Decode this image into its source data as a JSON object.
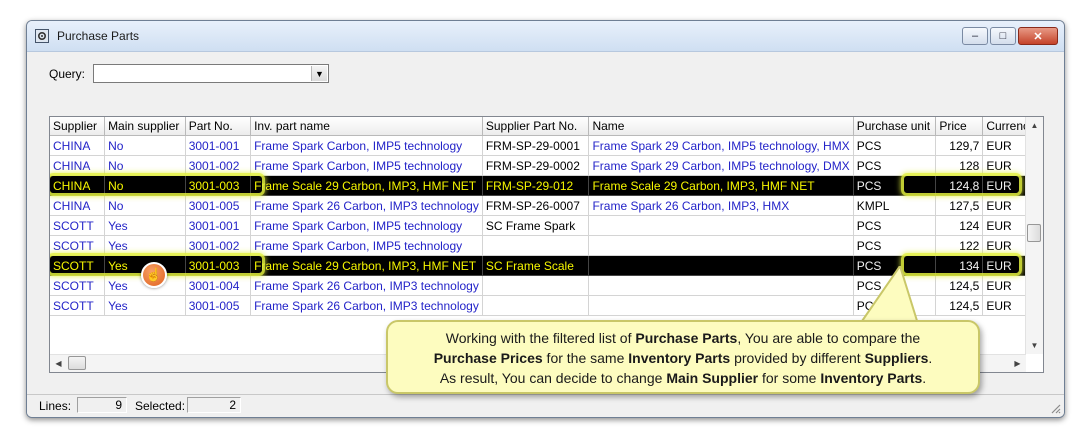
{
  "window": {
    "title": "Purchase Parts",
    "buttons": {
      "minimize": "–",
      "maximize": "□",
      "close": "✕"
    }
  },
  "query": {
    "label": "Query:",
    "value": ""
  },
  "grid": {
    "columns": [
      "Supplier",
      "Main supplier",
      "Part No.",
      "Inv. part name",
      "Supplier Part No.",
      "Name",
      "Purchase unit",
      "Price",
      "Currency"
    ],
    "rows": [
      {
        "supplier": "CHINA",
        "main": "No",
        "part": "3001-001",
        "inv": "Frame Spark Carbon, IMP5 technology",
        "spn": "FRM-SP-29-0001",
        "name": "Frame Spark 29 Carbon, IMP5 technology, HMX",
        "unit": "PCS",
        "price": "129,7",
        "cur": "EUR",
        "sel": false
      },
      {
        "supplier": "CHINA",
        "main": "No",
        "part": "3001-002",
        "inv": "Frame Spark Carbon, IMP5 technology",
        "spn": "FRM-SP-29-0002",
        "name": "Frame Spark 29 Carbon, IMP5 technology, DMX",
        "unit": "PCS",
        "price": "128",
        "cur": "EUR",
        "sel": false
      },
      {
        "supplier": "CHINA",
        "main": "No",
        "part": "3001-003",
        "inv": "Frame Scale 29 Carbon, IMP3, HMF NET",
        "spn": "FRM-SP-29-012",
        "name": "Frame Scale 29 Carbon, IMP3, HMF NET",
        "unit": "PCS",
        "price": "124,8",
        "cur": "EUR",
        "sel": true
      },
      {
        "supplier": "CHINA",
        "main": "No",
        "part": "3001-005",
        "inv": "Frame Spark 26 Carbon, IMP3 technology",
        "spn": "FRM-SP-26-0007",
        "name": "Frame Spark 26 Carbon, IMP3, HMX",
        "unit": "KMPL",
        "price": "127,5",
        "cur": "EUR",
        "sel": false
      },
      {
        "supplier": "SCOTT",
        "main": "Yes",
        "part": "3001-001",
        "inv": "Frame Spark Carbon, IMP5 technology",
        "spn": "SC Frame Spark",
        "name": "",
        "unit": "PCS",
        "price": "124",
        "cur": "EUR",
        "sel": false
      },
      {
        "supplier": "SCOTT",
        "main": "Yes",
        "part": "3001-002",
        "inv": "Frame Spark Carbon, IMP5 technology",
        "spn": "",
        "name": "",
        "unit": "PCS",
        "price": "122",
        "cur": "EUR",
        "sel": false
      },
      {
        "supplier": "SCOTT",
        "main": "Yes",
        "part": "3001-003",
        "inv": "Frame Scale 29 Carbon, IMP3, HMF NET",
        "spn": "SC Frame Scale",
        "name": "",
        "unit": "PCS",
        "price": "134",
        "cur": "EUR",
        "sel": true
      },
      {
        "supplier": "SCOTT",
        "main": "Yes",
        "part": "3001-004",
        "inv": "Frame Spark 26 Carbon, IMP3 technology",
        "spn": "",
        "name": "",
        "unit": "PCS",
        "price": "124,5",
        "cur": "EUR",
        "sel": false
      },
      {
        "supplier": "SCOTT",
        "main": "Yes",
        "part": "3001-005",
        "inv": "Frame Spark 26 Carbon, IMP3 technology",
        "spn": "",
        "name": "",
        "unit": "PCS",
        "price": "124,5",
        "cur": "EUR",
        "sel": false
      }
    ]
  },
  "status": {
    "lines_label": "Lines:",
    "lines": "9",
    "selected_label": "Selected:",
    "selected": "2"
  },
  "callout": {
    "segments": [
      [
        {
          "t": "Working with the filtered list of ",
          "b": false
        },
        {
          "t": "Purchase Parts",
          "b": true
        },
        {
          "t": ", You are able to compare the",
          "b": false
        }
      ],
      [
        {
          "t": "Purchase Prices",
          "b": true
        },
        {
          "t": " for the same ",
          "b": false
        },
        {
          "t": "Inventory Parts",
          "b": true
        },
        {
          "t": " provided by different ",
          "b": false
        },
        {
          "t": "Suppliers",
          "b": true
        },
        {
          "t": ".",
          "b": false
        }
      ],
      [
        {
          "t": "As result, You can decide to change ",
          "b": false
        },
        {
          "t": "Main Supplier",
          "b": true
        },
        {
          "t": " for some ",
          "b": false
        },
        {
          "t": "Inventory Parts",
          "b": true
        },
        {
          "t": ".",
          "b": false
        }
      ]
    ]
  },
  "icons": {
    "window": "gear-window-icon",
    "cursor": "hand-pointer-icon",
    "dropdown": "chevron-down-icon"
  },
  "colors": {
    "link_text": "#2323c8",
    "selected_bg": "#000000",
    "selected_text": "#f7f700",
    "highlight": "#e2f03c",
    "callout_bg": "#fdfcbf"
  }
}
